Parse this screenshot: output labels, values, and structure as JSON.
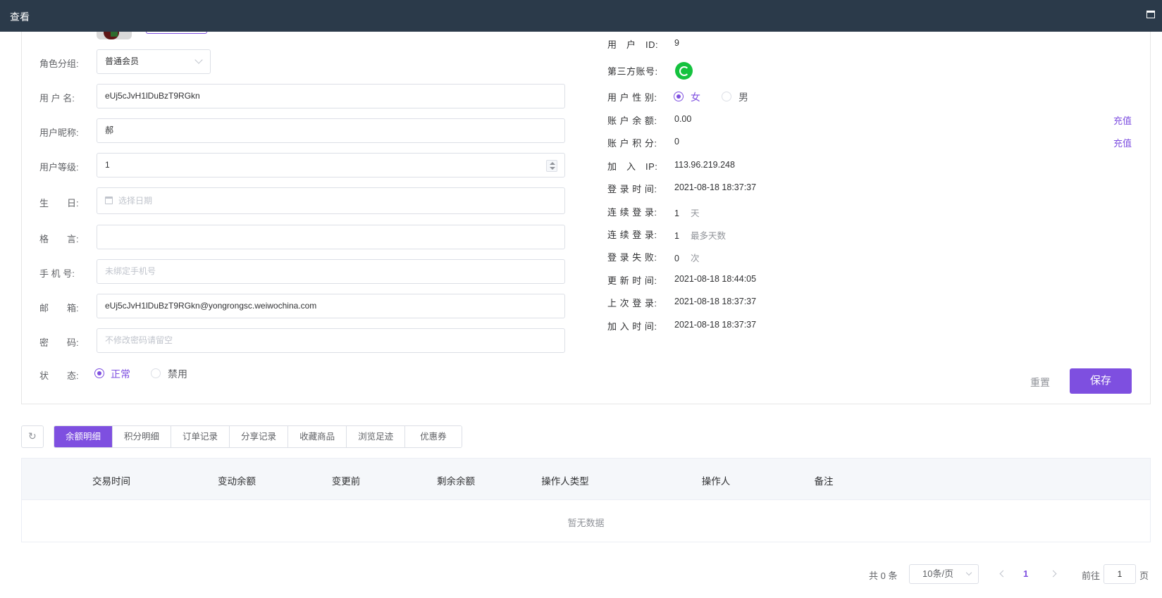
{
  "window": {
    "title": "查看"
  },
  "form": {
    "role_label": "角色分组:",
    "role_value": "普通会员",
    "username_label": "用 户 名:",
    "username_value": "eUj5cJvH1lDuBzT9RGkn",
    "nickname_label": "用户昵称:",
    "nickname_value": "郝",
    "level_label": "用户等级:",
    "level_value": "1",
    "birthday_label": "生　　日:",
    "birthday_placeholder": "选择日期",
    "motto_label": "格　　言:",
    "motto_value": "",
    "phone_label": "手 机 号:",
    "phone_placeholder": "未绑定手机号",
    "email_label": "邮　　箱:",
    "email_value": "eUj5cJvH1lDuBzT9RGkn@yongrongsc.weiwochina.com",
    "password_label": "密　　码:",
    "password_placeholder": "不修改密码请留空",
    "status_label": "状　　态:",
    "status_normal": "正常",
    "status_disabled": "禁用"
  },
  "info": {
    "user_id_label": "用　户　ID:",
    "user_id_value": "9",
    "third_party_label": "第三方账号:",
    "gender_label": "用 户 性 别:",
    "gender_female": "女",
    "gender_male": "男",
    "balance_label": "账 户 余 额:",
    "balance_value": "0.00",
    "points_label": "账 户 积 分:",
    "points_value": "0",
    "recharge": "充值",
    "join_ip_label": "加　入　IP:",
    "join_ip_value": "113.96.219.248",
    "login_time_label": "登 录 时 间:",
    "login_time_value": "2021-08-18 18:37:37",
    "consecutive_label": "连 续 登 录:",
    "consecutive_value": "1",
    "consecutive_unit": "天",
    "max_consecutive_label": "连 续 登 录:",
    "max_consecutive_value": "1",
    "max_consecutive_unit": "最多天数",
    "login_fail_label": "登 录 失 败:",
    "login_fail_value": "0",
    "login_fail_unit": "次",
    "update_time_label": "更 新 时 间:",
    "update_time_value": "2021-08-18 18:44:05",
    "last_login_label": "上 次 登 录:",
    "last_login_value": "2021-08-18 18:37:37",
    "join_time_label": "加 入 时 间:",
    "join_time_value": "2021-08-18 18:37:37"
  },
  "actions": {
    "reset": "重置",
    "save": "保存"
  },
  "tabs": [
    "余额明细",
    "积分明细",
    "订单记录",
    "分享记录",
    "收藏商品",
    "浏览足迹",
    "优惠券"
  ],
  "table": {
    "columns": [
      "交易时间",
      "变动余额",
      "变更前",
      "剩余余额",
      "操作人类型",
      "操作人",
      "备注"
    ],
    "empty": "暂无数据"
  },
  "pager": {
    "total": "共 0 条",
    "page_size": "10条/页",
    "current": "1",
    "goto_prefix": "前往",
    "goto_value": "1",
    "goto_suffix": "页"
  },
  "colors": {
    "accent": "#7e4fe0",
    "titlebar": "#2b3a4a",
    "wechat": "#14c23e"
  }
}
